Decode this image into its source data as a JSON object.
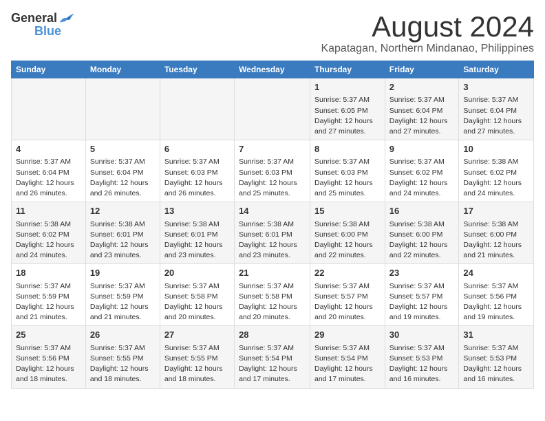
{
  "logo": {
    "general": "General",
    "blue": "Blue"
  },
  "title": "August 2024",
  "location": "Kapatagan, Northern Mindanao, Philippines",
  "days_header": [
    "Sunday",
    "Monday",
    "Tuesday",
    "Wednesday",
    "Thursday",
    "Friday",
    "Saturday"
  ],
  "weeks": [
    [
      {
        "day": "",
        "info": ""
      },
      {
        "day": "",
        "info": ""
      },
      {
        "day": "",
        "info": ""
      },
      {
        "day": "",
        "info": ""
      },
      {
        "day": "1",
        "info": "Sunrise: 5:37 AM\nSunset: 6:05 PM\nDaylight: 12 hours\nand 27 minutes."
      },
      {
        "day": "2",
        "info": "Sunrise: 5:37 AM\nSunset: 6:04 PM\nDaylight: 12 hours\nand 27 minutes."
      },
      {
        "day": "3",
        "info": "Sunrise: 5:37 AM\nSunset: 6:04 PM\nDaylight: 12 hours\nand 27 minutes."
      }
    ],
    [
      {
        "day": "4",
        "info": "Sunrise: 5:37 AM\nSunset: 6:04 PM\nDaylight: 12 hours\nand 26 minutes."
      },
      {
        "day": "5",
        "info": "Sunrise: 5:37 AM\nSunset: 6:04 PM\nDaylight: 12 hours\nand 26 minutes."
      },
      {
        "day": "6",
        "info": "Sunrise: 5:37 AM\nSunset: 6:03 PM\nDaylight: 12 hours\nand 26 minutes."
      },
      {
        "day": "7",
        "info": "Sunrise: 5:37 AM\nSunset: 6:03 PM\nDaylight: 12 hours\nand 25 minutes."
      },
      {
        "day": "8",
        "info": "Sunrise: 5:37 AM\nSunset: 6:03 PM\nDaylight: 12 hours\nand 25 minutes."
      },
      {
        "day": "9",
        "info": "Sunrise: 5:37 AM\nSunset: 6:02 PM\nDaylight: 12 hours\nand 24 minutes."
      },
      {
        "day": "10",
        "info": "Sunrise: 5:38 AM\nSunset: 6:02 PM\nDaylight: 12 hours\nand 24 minutes."
      }
    ],
    [
      {
        "day": "11",
        "info": "Sunrise: 5:38 AM\nSunset: 6:02 PM\nDaylight: 12 hours\nand 24 minutes."
      },
      {
        "day": "12",
        "info": "Sunrise: 5:38 AM\nSunset: 6:01 PM\nDaylight: 12 hours\nand 23 minutes."
      },
      {
        "day": "13",
        "info": "Sunrise: 5:38 AM\nSunset: 6:01 PM\nDaylight: 12 hours\nand 23 minutes."
      },
      {
        "day": "14",
        "info": "Sunrise: 5:38 AM\nSunset: 6:01 PM\nDaylight: 12 hours\nand 23 minutes."
      },
      {
        "day": "15",
        "info": "Sunrise: 5:38 AM\nSunset: 6:00 PM\nDaylight: 12 hours\nand 22 minutes."
      },
      {
        "day": "16",
        "info": "Sunrise: 5:38 AM\nSunset: 6:00 PM\nDaylight: 12 hours\nand 22 minutes."
      },
      {
        "day": "17",
        "info": "Sunrise: 5:38 AM\nSunset: 6:00 PM\nDaylight: 12 hours\nand 21 minutes."
      }
    ],
    [
      {
        "day": "18",
        "info": "Sunrise: 5:37 AM\nSunset: 5:59 PM\nDaylight: 12 hours\nand 21 minutes."
      },
      {
        "day": "19",
        "info": "Sunrise: 5:37 AM\nSunset: 5:59 PM\nDaylight: 12 hours\nand 21 minutes."
      },
      {
        "day": "20",
        "info": "Sunrise: 5:37 AM\nSunset: 5:58 PM\nDaylight: 12 hours\nand 20 minutes."
      },
      {
        "day": "21",
        "info": "Sunrise: 5:37 AM\nSunset: 5:58 PM\nDaylight: 12 hours\nand 20 minutes."
      },
      {
        "day": "22",
        "info": "Sunrise: 5:37 AM\nSunset: 5:57 PM\nDaylight: 12 hours\nand 20 minutes."
      },
      {
        "day": "23",
        "info": "Sunrise: 5:37 AM\nSunset: 5:57 PM\nDaylight: 12 hours\nand 19 minutes."
      },
      {
        "day": "24",
        "info": "Sunrise: 5:37 AM\nSunset: 5:56 PM\nDaylight: 12 hours\nand 19 minutes."
      }
    ],
    [
      {
        "day": "25",
        "info": "Sunrise: 5:37 AM\nSunset: 5:56 PM\nDaylight: 12 hours\nand 18 minutes."
      },
      {
        "day": "26",
        "info": "Sunrise: 5:37 AM\nSunset: 5:55 PM\nDaylight: 12 hours\nand 18 minutes."
      },
      {
        "day": "27",
        "info": "Sunrise: 5:37 AM\nSunset: 5:55 PM\nDaylight: 12 hours\nand 18 minutes."
      },
      {
        "day": "28",
        "info": "Sunrise: 5:37 AM\nSunset: 5:54 PM\nDaylight: 12 hours\nand 17 minutes."
      },
      {
        "day": "29",
        "info": "Sunrise: 5:37 AM\nSunset: 5:54 PM\nDaylight: 12 hours\nand 17 minutes."
      },
      {
        "day": "30",
        "info": "Sunrise: 5:37 AM\nSunset: 5:53 PM\nDaylight: 12 hours\nand 16 minutes."
      },
      {
        "day": "31",
        "info": "Sunrise: 5:37 AM\nSunset: 5:53 PM\nDaylight: 12 hours\nand 16 minutes."
      }
    ]
  ]
}
